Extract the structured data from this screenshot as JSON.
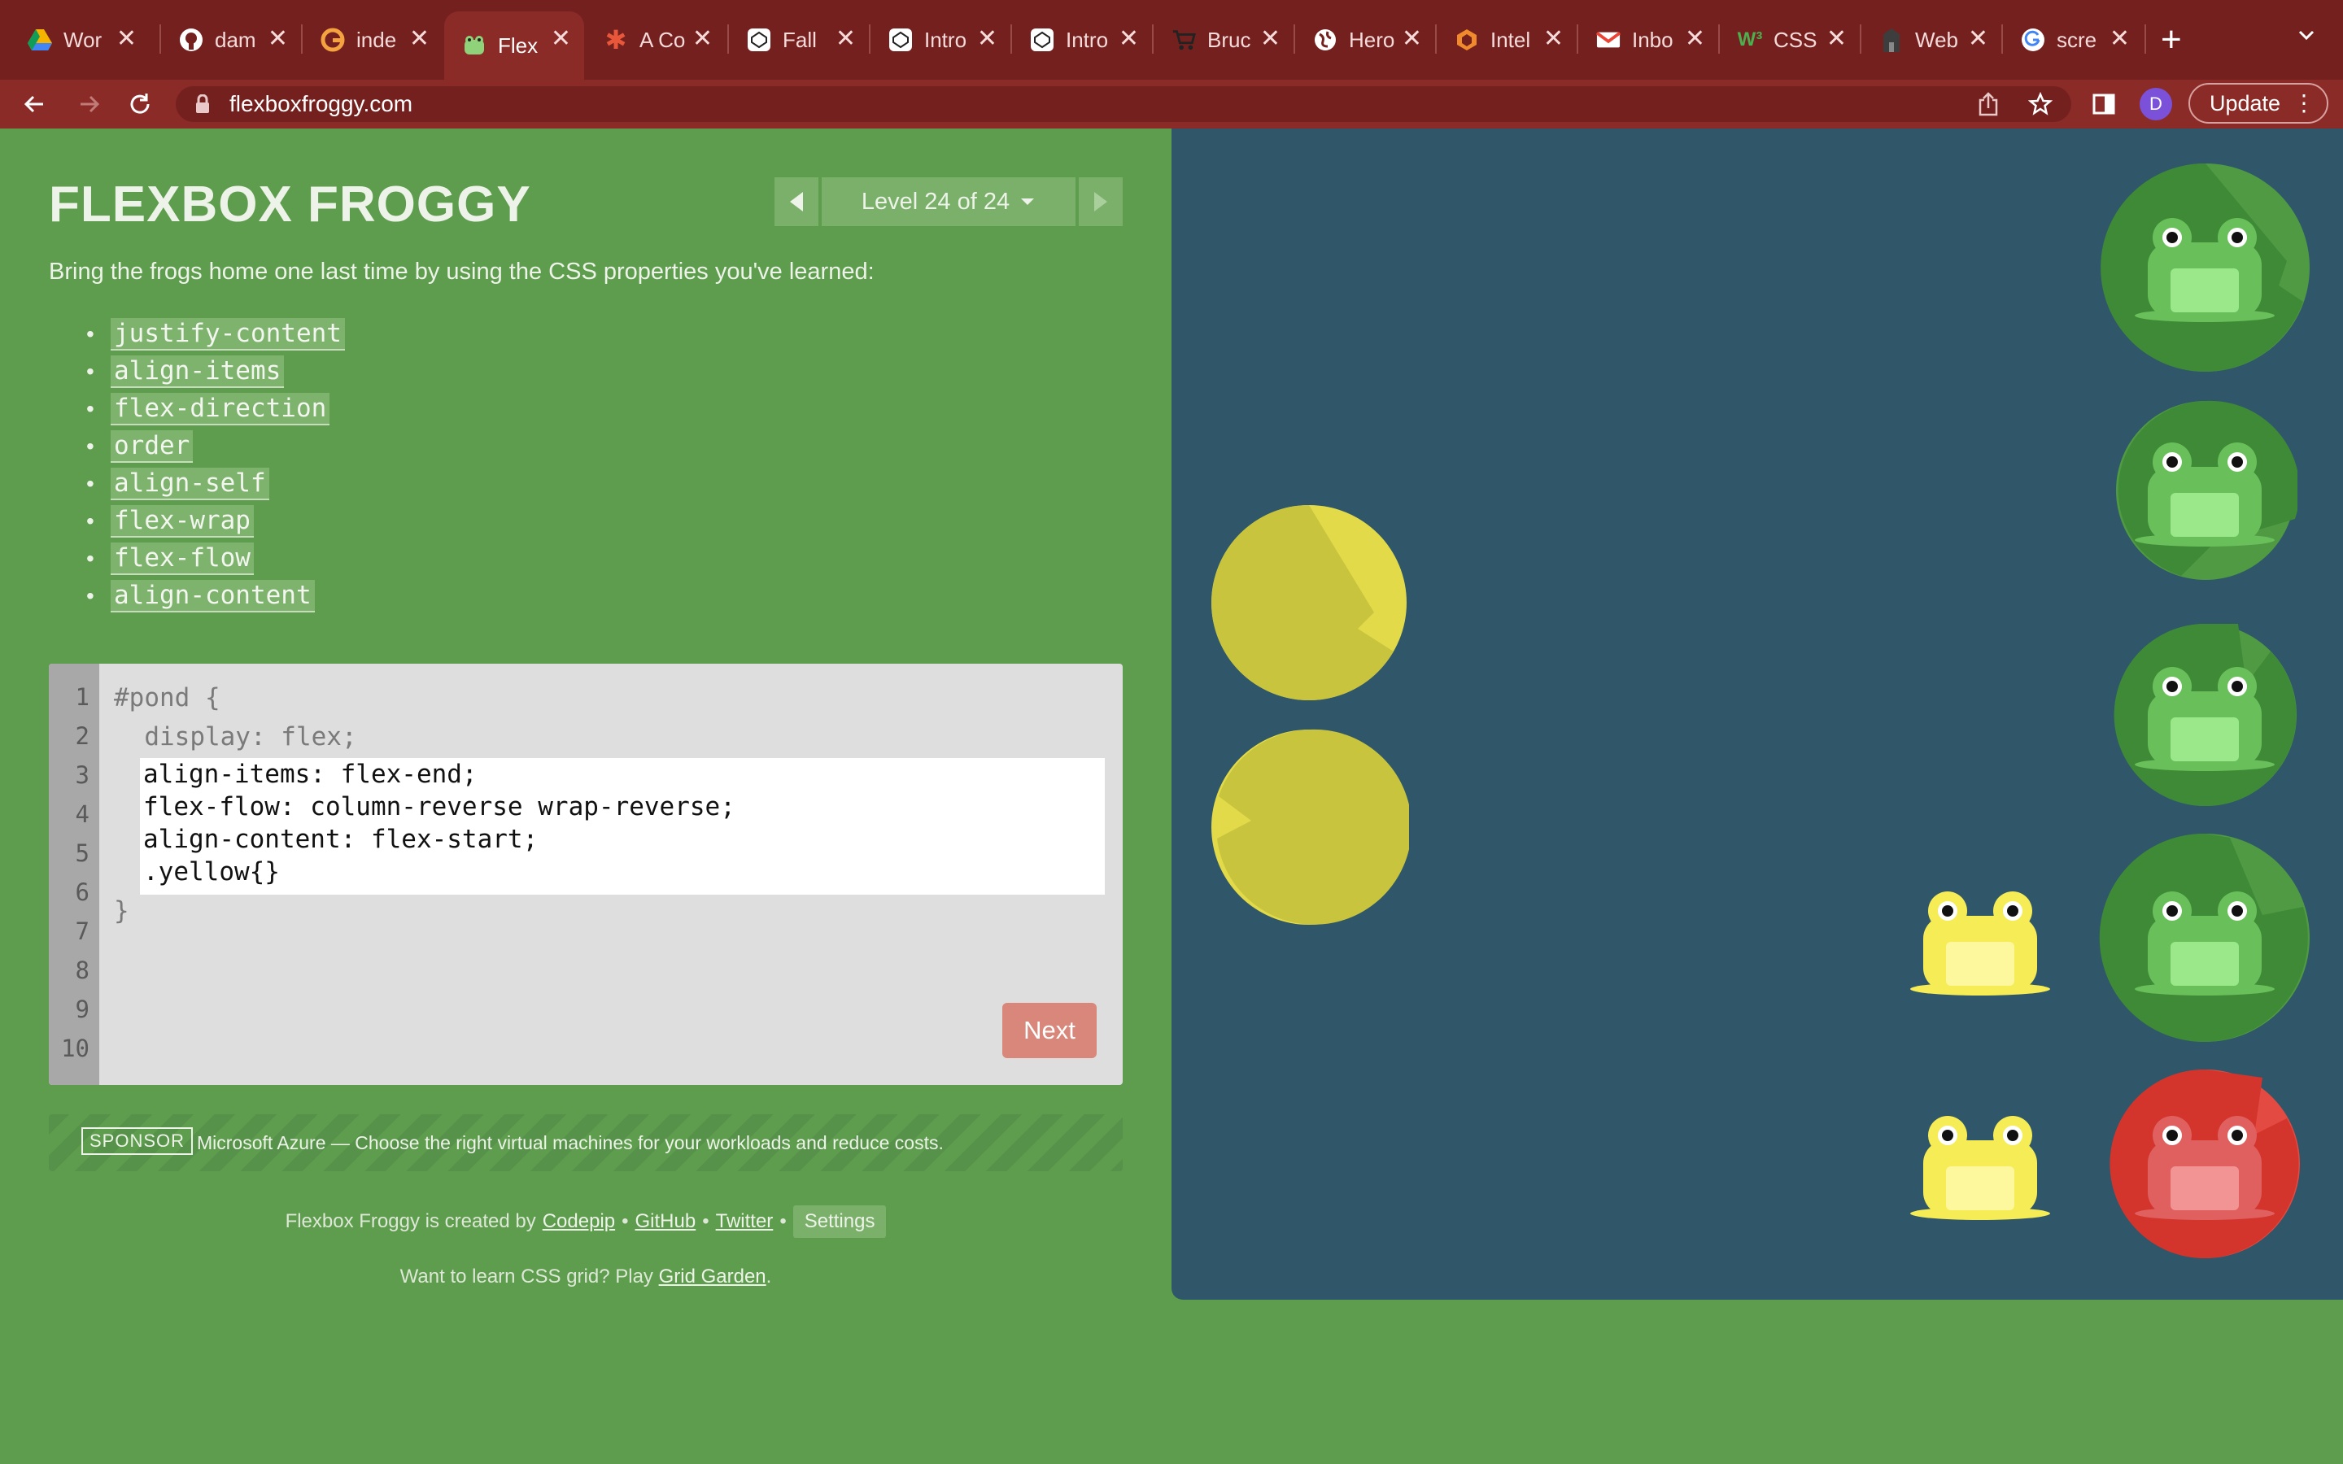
{
  "browser": {
    "tabs": [
      {
        "title": "Wor",
        "icon": "google-drive-icon"
      },
      {
        "title": "dam",
        "icon": "github-icon"
      },
      {
        "title": "inde",
        "icon": "gitbook-icon"
      },
      {
        "title": "Flex",
        "icon": "frog-icon",
        "active": true
      },
      {
        "title": "A Co",
        "icon": "asterisk-icon"
      },
      {
        "title": "Fall",
        "icon": "codepen-icon"
      },
      {
        "title": "Intro",
        "icon": "codepen-icon"
      },
      {
        "title": "Intro",
        "icon": "codepen-icon"
      },
      {
        "title": "Bruc",
        "icon": "cart-icon"
      },
      {
        "title": "Hero",
        "icon": "globe-icon"
      },
      {
        "title": "Intel",
        "icon": "hexagon-icon"
      },
      {
        "title": "Inbo",
        "icon": "gmail-icon"
      },
      {
        "title": "CSS",
        "icon": "w3schools-icon"
      },
      {
        "title": "Web",
        "icon": "building-icon"
      },
      {
        "title": "scre",
        "icon": "google-icon"
      }
    ],
    "url": "flexboxfroggy.com",
    "avatar_letter": "D",
    "update_label": "Update"
  },
  "game": {
    "title": "FLEXBOX FROGGY",
    "level_label": "Level 24 of 24",
    "instructions": "Bring the frogs home one last time by using the CSS properties you've learned:",
    "properties": [
      "justify-content",
      "align-items",
      "flex-direction",
      "order",
      "align-self",
      "flex-wrap",
      "flex-flow",
      "align-content"
    ],
    "editor": {
      "line_numbers": [
        "1",
        "2",
        "3",
        "4",
        "5",
        "6",
        "7",
        "8",
        "9",
        "10"
      ],
      "line1": "#pond {",
      "line2": "  display: flex;",
      "input_value": "align-items: flex-end;\nflex-flow: column-reverse wrap-reverse;\nalign-content: flex-start;\n.yellow{}",
      "closing": "}"
    },
    "next_label": "Next",
    "sponsor_tag": "SPONSOR",
    "sponsor_text": "Microsoft Azure — Choose the right virtual machines for your workloads and reduce costs.",
    "credits": {
      "prefix": "Flexbox Froggy is created by",
      "codepip": "Codepip",
      "github": "GitHub",
      "twitter": "Twitter",
      "sep": "•",
      "settings": "Settings"
    },
    "grid_prompt": "Want to learn CSS grid? Play",
    "grid_link": "Grid Garden",
    "grid_end": "."
  },
  "pond": {
    "pad_colors": {
      "green": "#3f8a36",
      "yellow": "#c8c43e",
      "red": "#d3352d"
    },
    "frog_colors": {
      "green": "#69c05a",
      "yellow": "#f6ec56",
      "red": "#e06060"
    }
  }
}
